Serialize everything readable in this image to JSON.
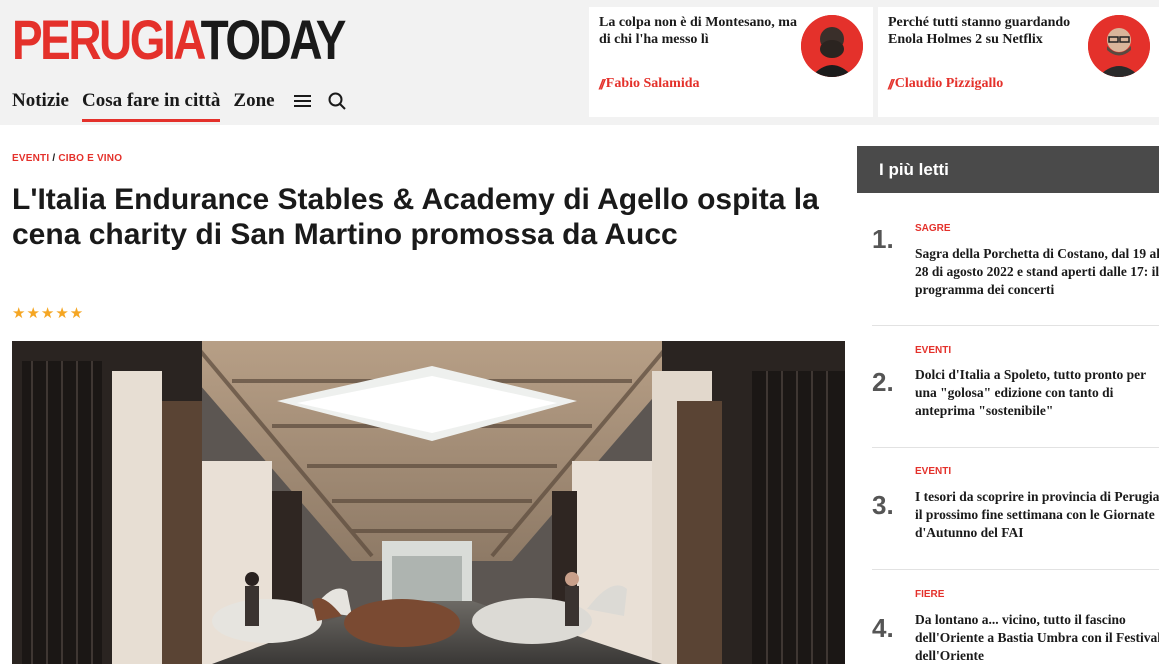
{
  "header": {
    "logo_part1": "PERUGIA",
    "logo_part2": "TODAY",
    "nav": [
      "Notizie",
      "Cosa fare in città",
      "Zone"
    ],
    "cards": [
      {
        "title": "La colpa non è di Montesano, ma di chi l'ha messo lì",
        "author": "Fabio Salamida"
      },
      {
        "title": "Perché tutti stanno guardando Enola Holmes 2 su Netflix",
        "author": "Claudio Pizzigallo"
      }
    ]
  },
  "article": {
    "breadcrumb": [
      "EVENTI",
      "CIBO E VINO"
    ],
    "breadcrumb_sep": "/",
    "title": "L'Italia Endurance Stables & Academy di Agello ospita la cena charity di San Martino promossa da Aucc",
    "rating_stars": "★★★★★"
  },
  "sidebar": {
    "title": "I più letti",
    "items": [
      {
        "num": "1.",
        "category": "SAGRE",
        "title": "Sagra della Porchetta di Costano, dal 19 al 28 di agosto 2022 e stand aperti dalle 17: il programma dei concerti"
      },
      {
        "num": "2.",
        "category": "EVENTI",
        "title": "Dolci d'Italia a Spoleto, tutto pronto per una \"golosa\" edizione con tanto di anteprima \"sostenibile\""
      },
      {
        "num": "3.",
        "category": "EVENTI",
        "title": "I tesori da scoprire in provincia di Perugia il prossimo fine settimana con le Giornate d'Autunno del FAI"
      },
      {
        "num": "4.",
        "category": "FIERE",
        "title": "Da lontano a... vicino, tutto il fascino dell'Oriente a Bastia Umbra con il Festival dell'Oriente"
      }
    ]
  },
  "colors": {
    "brand_red": "#e4312b",
    "sidebar_header": "#4a4a4a",
    "star": "#f5a623"
  },
  "icons": [
    "menu-icon",
    "search-icon"
  ]
}
